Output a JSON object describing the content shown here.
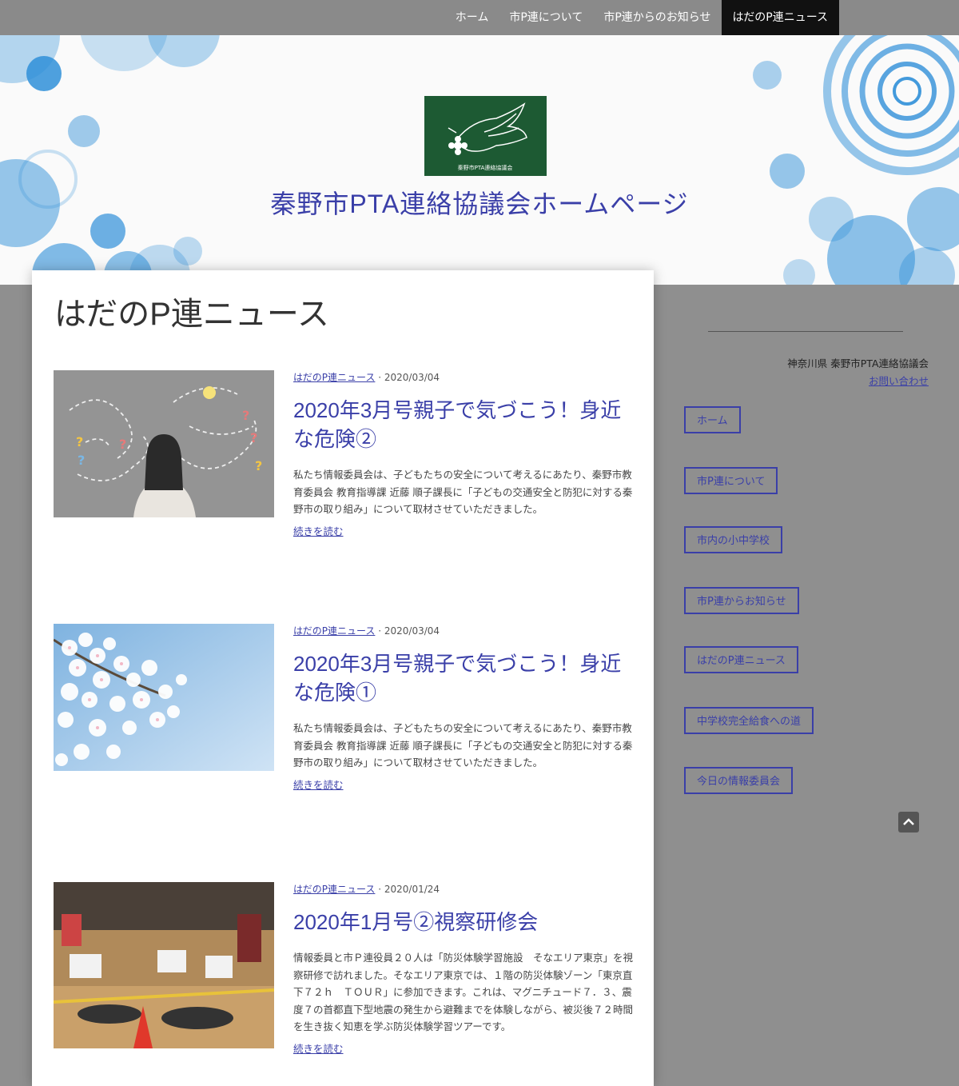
{
  "nav": {
    "items": [
      "ホーム",
      "市P連について",
      "市P連からのお知らせ",
      "はだのP連ニュース"
    ],
    "active_index": 3
  },
  "header": {
    "logo_text": "秦野市PTA連絡協議会",
    "site_title": "秦野市PTA連絡協議会ホームページ"
  },
  "main": {
    "page_title": "はだのP連ニュース",
    "posts": [
      {
        "category": "はだのP連ニュース",
        "date": "2020/03/04",
        "title": "2020年3月号親子で気づこう！身近な危険②",
        "excerpt": "私たち情報委員会は、子どもたちの安全について考えるにあたり、秦野市教育委員会 教育指導課 近藤 順子課長に「子どもの交通安全と防犯に対する秦野市の取り組み」について取材させていただきました。",
        "read_more": "続きを読む"
      },
      {
        "category": "はだのP連ニュース",
        "date": "2020/03/04",
        "title": "2020年3月号親子で気づこう！身近な危険①",
        "excerpt": "私たち情報委員会は、子どもたちの安全について考えるにあたり、秦野市教育委員会 教育指導課 近藤 順子課長に「子どもの交通安全と防犯に対する秦野市の取り組み」について取材させていただきました。",
        "read_more": "続きを読む"
      },
      {
        "category": "はだのP連ニュース",
        "date": "2020/01/24",
        "title": "2020年1月号②視察研修会",
        "excerpt": "情報委員と市Ｐ連役員２０人は「防災体験学習施設　そなエリア東京」を視察研修で訪れました。そなエリア東京では、１階の防災体験ゾーン「東京直下７２ｈ　ＴＯＵＲ」に参加できます。これは、マグニチュード７．３、震度７の首都直下型地震の発生から避難までを体験しながら、被災後７２時間を生き抜く知恵を学ぶ防災体験学習ツアーです。",
        "read_more": "続きを読む"
      }
    ]
  },
  "sidebar": {
    "org": "神奈川県 秦野市PTA連絡協議会",
    "contact": "お問い合わせ",
    "buttons": [
      "ホーム",
      "市P連について",
      "市内の小中学校",
      "市P連からお知らせ",
      "はだのP連ニュース",
      "中学校完全給食への道",
      "今日の情報委員会"
    ]
  },
  "colors": {
    "accent": "#3a3fa8",
    "bubble": "#2f8fd8",
    "logo_bg": "#1d5a33",
    "nav_active": "#111111"
  },
  "icons": [
    "logo-dove-icon",
    "back-to-top-icon"
  ]
}
